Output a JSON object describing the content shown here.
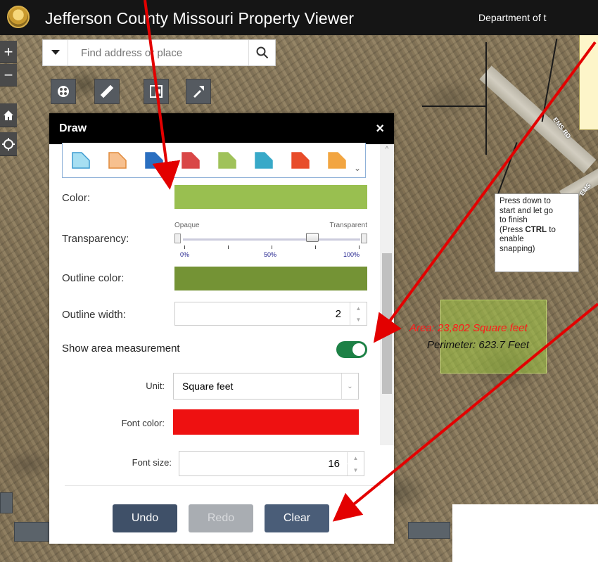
{
  "header": {
    "title": "Jefferson County Missouri Property Viewer",
    "department": "Department of t"
  },
  "map_controls": {
    "zoom_in": "+",
    "zoom_out": "−"
  },
  "search": {
    "placeholder": "Find address or place"
  },
  "toolbar": {
    "tools": [
      "layers-icon",
      "measure-icon",
      "select-icon",
      "draw-icon"
    ]
  },
  "draw_panel": {
    "title": "Draw",
    "close": "×",
    "swatches": [
      {
        "fill": "#a7dff2",
        "stroke": "#3c9ad0"
      },
      {
        "fill": "#f7c08f",
        "stroke": "#e08a3c"
      },
      {
        "fill": "#2a6fc0",
        "stroke": "#2a6fc0"
      },
      {
        "fill": "#d94747",
        "stroke": "#d94747"
      },
      {
        "fill": "#a0c25a",
        "stroke": "#a0c25a"
      },
      {
        "fill": "#38a9c8",
        "stroke": "#38a9c8"
      },
      {
        "fill": "#e84c2a",
        "stroke": "#e84c2a"
      },
      {
        "fill": "#f2a541",
        "stroke": "#f2a541"
      }
    ],
    "color_label": "Color:",
    "color_value": "#99bf50",
    "transparency_label": "Transparency:",
    "transparency": {
      "opaque": "Opaque",
      "transparent": "Transparent",
      "ticks": [
        "0%",
        "50%",
        "100%"
      ],
      "value_percent": 73
    },
    "outline_color_label": "Outline color:",
    "outline_color_value": "#749335",
    "outline_width_label": "Outline width:",
    "outline_width_value": "2",
    "show_area_label": "Show area measurement",
    "show_area_enabled": true,
    "unit_label": "Unit:",
    "unit_value": "Square feet",
    "font_color_label": "Font color:",
    "font_color_value": "#ee1111",
    "font_size_label": "Font size:",
    "font_size_value": "16",
    "buttons": {
      "undo": "Undo",
      "redo": "Redo",
      "clear": "Clear"
    }
  },
  "map_overlay": {
    "area_text": "Area: 23,802 Square feet",
    "perimeter_text": "Perimeter: 623.7 Feet",
    "tooltip_lines": [
      "Press down to",
      "start and let go",
      "to finish",
      "(Press ",
      "CTRL",
      " to",
      "enable",
      "snapping)"
    ],
    "road_labels": [
      "EMS RD",
      "EMS"
    ]
  },
  "colors": {
    "header_bg": "#151515",
    "undo_bg": "#3f5068",
    "redo_bg": "#a9adb2",
    "clear_bg": "#4a5d78",
    "arrow": "#e30000"
  }
}
